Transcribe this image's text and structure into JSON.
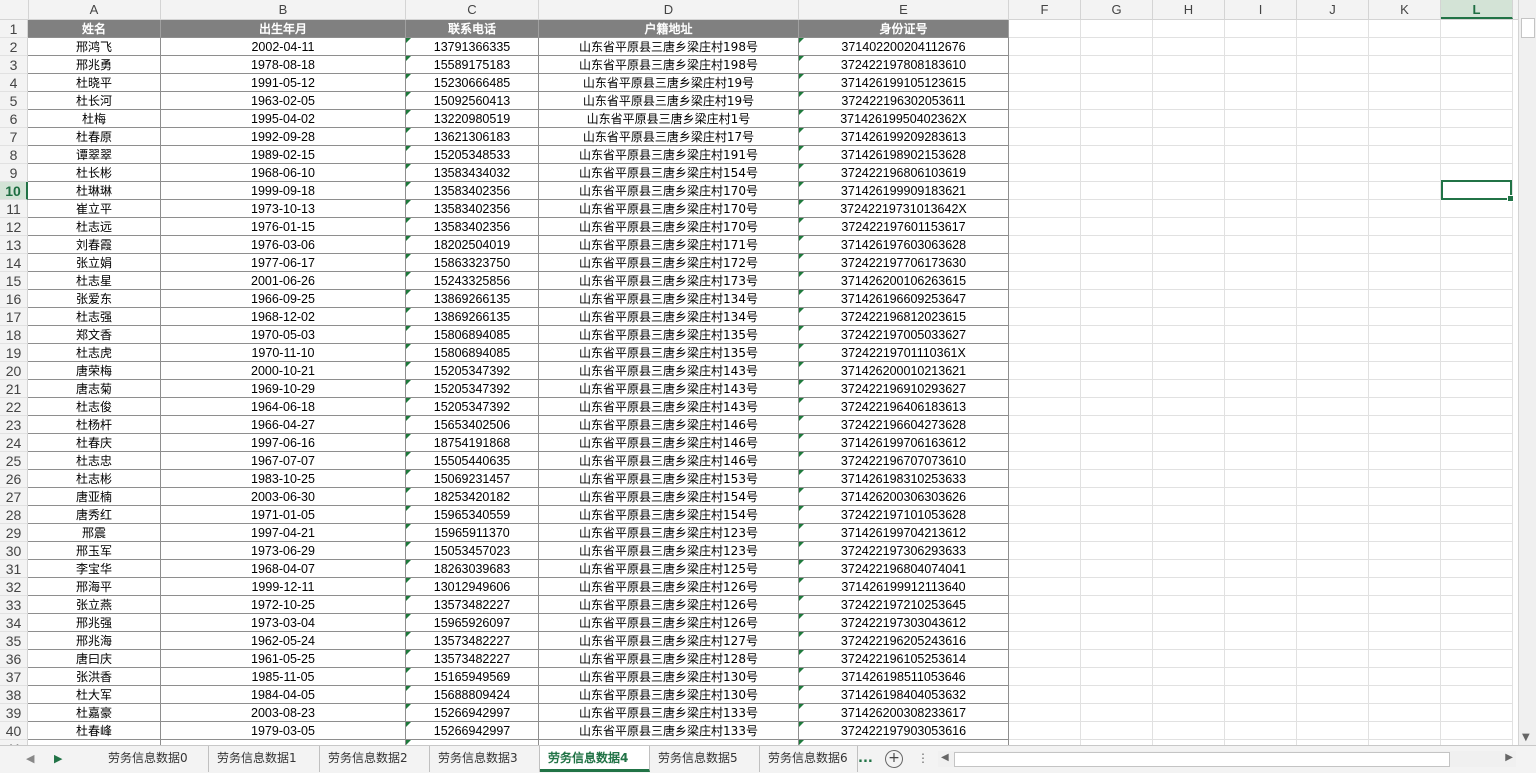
{
  "column_letters": [
    "A",
    "B",
    "C",
    "D",
    "E",
    "F",
    "G",
    "H",
    "I",
    "J",
    "K",
    "L"
  ],
  "selected_column": "L",
  "selected_row": "10",
  "header": [
    "姓名",
    "出生年月",
    "联系电话",
    "户籍地址",
    "身份证号"
  ],
  "rows": [
    [
      "邢鸿飞",
      "2002-04-11",
      "13791366335",
      "山东省平原县三唐乡梁庄村198号",
      "371402200204112676"
    ],
    [
      "邢兆勇",
      "1978-08-18",
      "15589175183",
      "山东省平原县三唐乡梁庄村198号",
      "372422197808183610"
    ],
    [
      "杜晓平",
      "1991-05-12",
      "15230666485",
      "山东省平原县三唐乡梁庄村19号",
      "371426199105123615"
    ],
    [
      "杜长河",
      "1963-02-05",
      "15092560413",
      "山东省平原县三唐乡梁庄村19号",
      "372422196302053611"
    ],
    [
      "杜梅",
      "1995-04-02",
      "13220980519",
      "山东省平原县三唐乡梁庄村1号",
      "37142619950402362X"
    ],
    [
      "杜春原",
      "1992-09-28",
      "13621306183",
      "山东省平原县三唐乡梁庄村17号",
      "371426199209283613"
    ],
    [
      "谭翠翠",
      "1989-02-15",
      "15205348533",
      "山东省平原县三唐乡梁庄村191号",
      "371426198902153628"
    ],
    [
      "杜长彬",
      "1968-06-10",
      "13583434032",
      "山东省平原县三唐乡梁庄村154号",
      "372422196806103619"
    ],
    [
      "杜琳琳",
      "1999-09-18",
      "13583402356",
      "山东省平原县三唐乡梁庄村170号",
      "371426199909183621"
    ],
    [
      "崔立平",
      "1973-10-13",
      "13583402356",
      "山东省平原县三唐乡梁庄村170号",
      "37242219731013642X"
    ],
    [
      "杜志远",
      "1976-01-15",
      "13583402356",
      "山东省平原县三唐乡梁庄村170号",
      "372422197601153617"
    ],
    [
      "刘春霞",
      "1976-03-06",
      "18202504019",
      "山东省平原县三唐乡梁庄村171号",
      "371426197603063628"
    ],
    [
      "张立娟",
      "1977-06-17",
      "15863323750",
      "山东省平原县三唐乡梁庄村172号",
      "372422197706173630"
    ],
    [
      "杜志星",
      "2001-06-26",
      "15243325856",
      "山东省平原县三唐乡梁庄村173号",
      "371426200106263615"
    ],
    [
      "张爱东",
      "1966-09-25",
      "13869266135",
      "山东省平原县三唐乡梁庄村134号",
      "371426196609253647"
    ],
    [
      "杜志强",
      "1968-12-02",
      "13869266135",
      "山东省平原县三唐乡梁庄村134号",
      "372422196812023615"
    ],
    [
      "郑文香",
      "1970-05-03",
      "15806894085",
      "山东省平原县三唐乡梁庄村135号",
      "372422197005033627"
    ],
    [
      "杜志虎",
      "1970-11-10",
      "15806894085",
      "山东省平原县三唐乡梁庄村135号",
      "37242219701110361X"
    ],
    [
      "唐荣梅",
      "2000-10-21",
      "15205347392",
      "山东省平原县三唐乡梁庄村143号",
      "371426200010213621"
    ],
    [
      "唐志菊",
      "1969-10-29",
      "15205347392",
      "山东省平原县三唐乡梁庄村143号",
      "372422196910293627"
    ],
    [
      "杜志俊",
      "1964-06-18",
      "15205347392",
      "山东省平原县三唐乡梁庄村143号",
      "372422196406183613"
    ],
    [
      "杜杨杆",
      "1966-04-27",
      "15653402506",
      "山东省平原县三唐乡梁庄村146号",
      "372422196604273628"
    ],
    [
      "杜春庆",
      "1997-06-16",
      "18754191868",
      "山东省平原县三唐乡梁庄村146号",
      "371426199706163612"
    ],
    [
      "杜志忠",
      "1967-07-07",
      "15505440635",
      "山东省平原县三唐乡梁庄村146号",
      "372422196707073610"
    ],
    [
      "杜志彬",
      "1983-10-25",
      "15069231457",
      "山东省平原县三唐乡梁庄村153号",
      "371426198310253633"
    ],
    [
      "唐亚楠",
      "2003-06-30",
      "18253420182",
      "山东省平原县三唐乡梁庄村154号",
      "371426200306303626"
    ],
    [
      "唐秀红",
      "1971-01-05",
      "15965340559",
      "山东省平原县三唐乡梁庄村154号",
      "372422197101053628"
    ],
    [
      "邢震",
      "1997-04-21",
      "15965911370",
      "山东省平原县三唐乡梁庄村123号",
      "371426199704213612"
    ],
    [
      "邢玉军",
      "1973-06-29",
      "15053457023",
      "山东省平原县三唐乡梁庄村123号",
      "372422197306293633"
    ],
    [
      "李宝华",
      "1968-04-07",
      "18263039683",
      "山东省平原县三唐乡梁庄村125号",
      "372422196804074041"
    ],
    [
      "邢海平",
      "1999-12-11",
      "13012949606",
      "山东省平原县三唐乡梁庄村126号",
      "371426199912113640"
    ],
    [
      "张立燕",
      "1972-10-25",
      "13573482227",
      "山东省平原县三唐乡梁庄村126号",
      "372422197210253645"
    ],
    [
      "邢兆强",
      "1973-03-04",
      "15965926097",
      "山东省平原县三唐乡梁庄村126号",
      "372422197303043612"
    ],
    [
      "邢兆海",
      "1962-05-24",
      "13573482227",
      "山东省平原县三唐乡梁庄村127号",
      "372422196205243616"
    ],
    [
      "唐曰庆",
      "1961-05-25",
      "13573482227",
      "山东省平原县三唐乡梁庄村128号",
      "372422196105253614"
    ],
    [
      "张洪香",
      "1985-11-05",
      "15165949569",
      "山东省平原县三唐乡梁庄村130号",
      "371426198511053646"
    ],
    [
      "杜大军",
      "1984-04-05",
      "15688809424",
      "山东省平原县三唐乡梁庄村130号",
      "371426198404053632"
    ],
    [
      "杜嘉豪",
      "2003-08-23",
      "15266942997",
      "山东省平原县三唐乡梁庄村133号",
      "371426200308233617"
    ],
    [
      "杜春峰",
      "1979-03-05",
      "15266942997",
      "山东省平原县三唐乡梁庄村133号",
      "372422197903053616"
    ]
  ],
  "sheet_tabs": [
    "劳务信息数据0",
    "劳务信息数据1",
    "劳务信息数据2",
    "劳务信息数据3",
    "劳务信息数据4",
    "劳务信息数据5",
    "劳务信息数据6"
  ],
  "active_tab": "劳务信息数据4",
  "tab_more": "...",
  "colors": {
    "header_bg": "#808080",
    "accent": "#217346",
    "gridline": "#e1e1e1"
  }
}
